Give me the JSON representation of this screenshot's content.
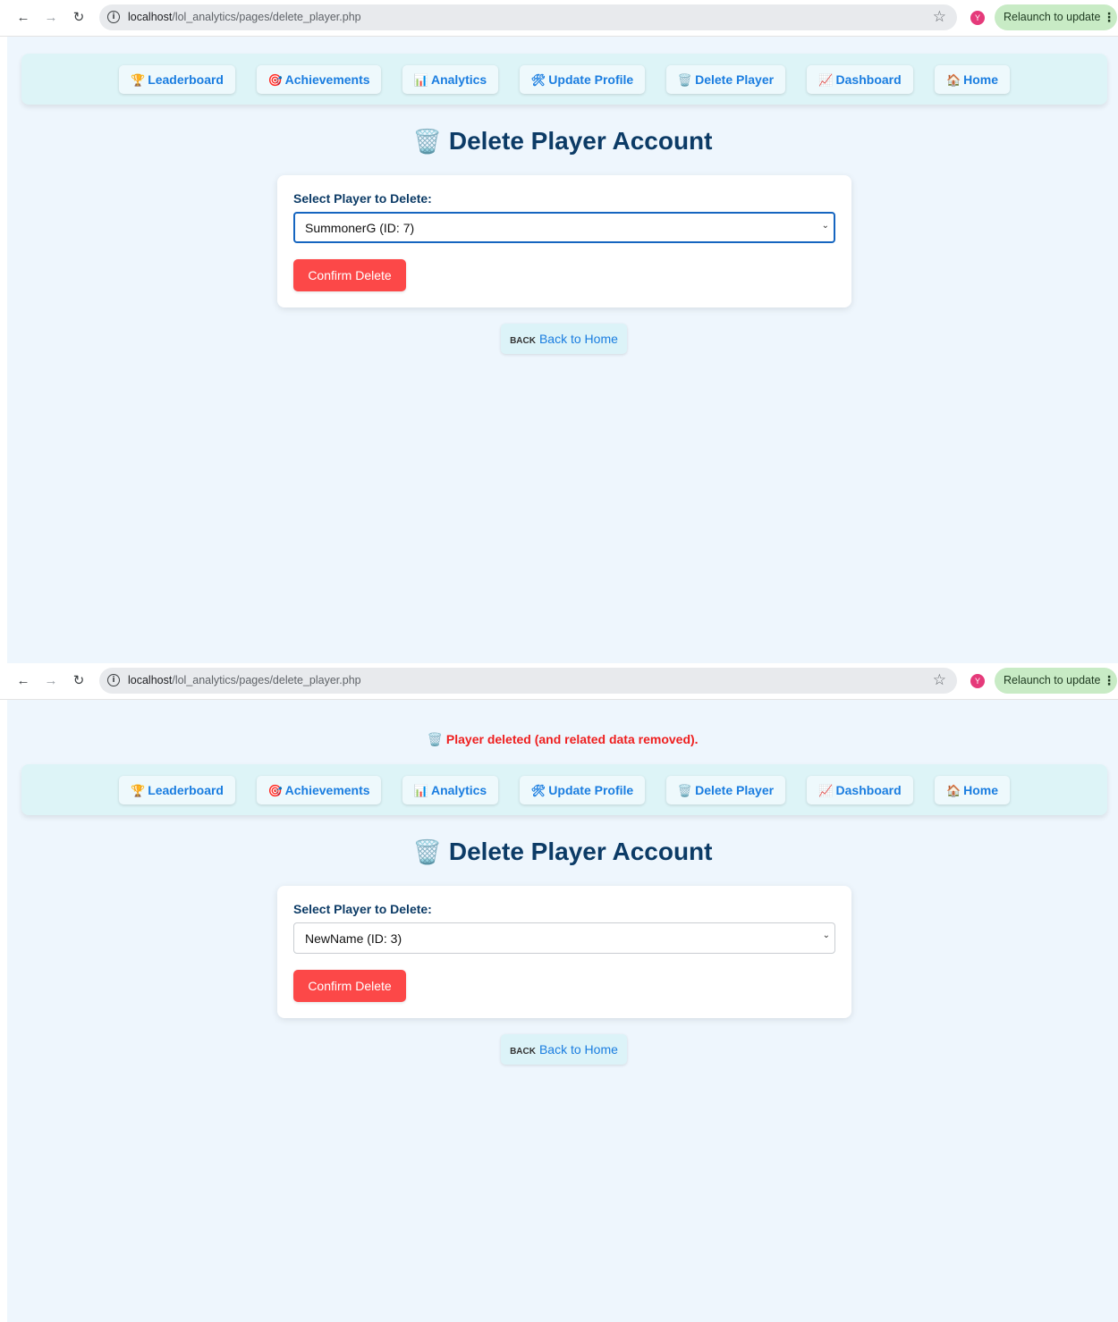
{
  "browser": {
    "url_host": "localhost",
    "url_path": "/lol_analytics/pages/delete_player.php",
    "info_icon": "i",
    "back_icon": "←",
    "forward_icon": "→",
    "reload_icon": "↻",
    "star_icon": "☆",
    "profile_initial": "Y",
    "relaunch_label": "Relaunch to update",
    "kebab_icon": "⋮"
  },
  "nav": [
    {
      "icon": "🏆",
      "label": "Leaderboard"
    },
    {
      "icon": "🎯",
      "label": "Achievements"
    },
    {
      "icon": "📊",
      "label": "Analytics"
    },
    {
      "icon": "🛠",
      "label": "Update Profile"
    },
    {
      "icon": "🗑️",
      "label": "Delete Player"
    },
    {
      "icon": "📈",
      "label": "Dashboard"
    },
    {
      "icon": "🏠",
      "label": "Home"
    }
  ],
  "page": {
    "title_icon": "🗑️",
    "title": "Delete Player Account",
    "select_label": "Select Player to Delete:",
    "confirm_label": "Confirm Delete",
    "back_icon": "BACK",
    "back_label": "Back to Home",
    "chevron": "⌄"
  },
  "screens": [
    {
      "flash": null,
      "selected_player": "SummonerG (ID: 7)"
    },
    {
      "flash": {
        "icon": "🗑️",
        "text": "Player deleted (and related data removed)."
      },
      "selected_player": "NewName (ID: 3)"
    }
  ],
  "colors": {
    "page_bg": "#eef6fd",
    "nav_bar": "#ddf4f7",
    "link": "#1a7de0",
    "heading": "#0c3b66",
    "danger": "#fc4848",
    "flash": "#ee1f1f",
    "relaunch_bg": "#c8ebc5"
  }
}
